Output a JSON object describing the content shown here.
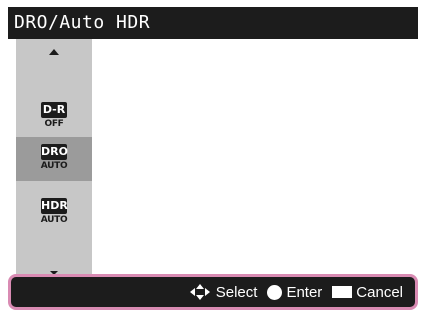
{
  "title": "DRO/Auto HDR",
  "options": [
    {
      "top": "D-R",
      "bottom": "OFF",
      "selected": false
    },
    {
      "top": "DRO",
      "bottom": "AUTO",
      "selected": true
    },
    {
      "top": "HDR",
      "bottom": "AUTO",
      "selected": false
    }
  ],
  "guide": {
    "select_label": "Select",
    "enter_label": "Enter",
    "cancel_label": "Cancel"
  },
  "colors": {
    "bar": "#1c1c1c",
    "panel": "#c7c7c7",
    "selected": "#9b9b9b",
    "highlight_border": "#d98bb3"
  }
}
